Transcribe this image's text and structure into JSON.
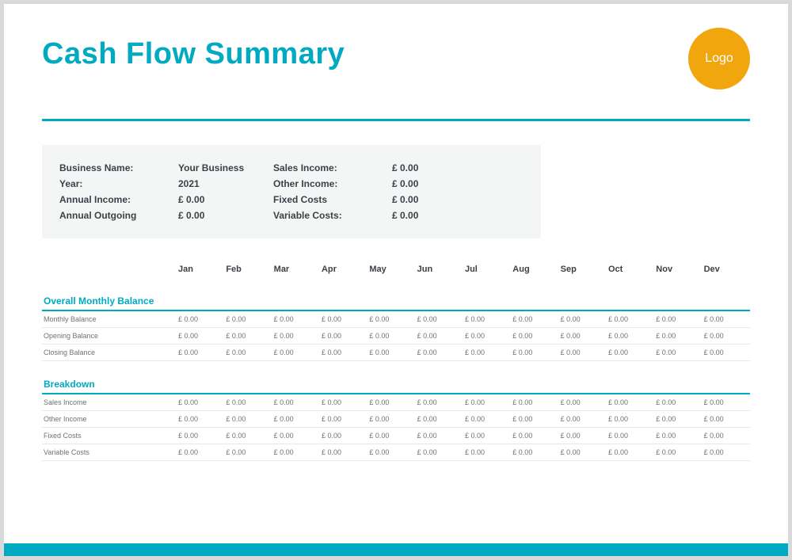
{
  "title": "Cash Flow Summary",
  "logo_text": "Logo",
  "summary": {
    "business_name_label": "Business Name:",
    "business_name_value": "Your Business",
    "year_label": "Year:",
    "year_value": "2021",
    "annual_income_label": "Annual Income:",
    "annual_income_value": "£ 0.00",
    "annual_outgoing_label": "Annual Outgoing",
    "annual_outgoing_value": "£ 0.00",
    "sales_income_label": "Sales Income:",
    "sales_income_value": "£ 0.00",
    "other_income_label": "Other Income:",
    "other_income_value": "£ 0.00",
    "fixed_costs_label": "Fixed Costs",
    "fixed_costs_value": "£ 0.00",
    "variable_costs_label": "Variable Costs:",
    "variable_costs_value": "£ 0.00"
  },
  "months": [
    "Jan",
    "Feb",
    "Mar",
    "Apr",
    "May",
    "Jun",
    "Jul",
    "Aug",
    "Sep",
    "Oct",
    "Nov",
    "Dev"
  ],
  "section1_title": "Overall Monthly Balance",
  "section1_rows": [
    {
      "label": "Monthly Balance",
      "vals": [
        "£ 0.00",
        "£ 0.00",
        "£ 0.00",
        "£ 0.00",
        "£ 0.00",
        "£ 0.00",
        "£ 0.00",
        "£ 0.00",
        "£ 0.00",
        "£ 0.00",
        "£ 0.00",
        "£ 0.00"
      ]
    },
    {
      "label": "Opening Balance",
      "vals": [
        "£ 0.00",
        "£ 0.00",
        "£ 0.00",
        "£ 0.00",
        "£ 0.00",
        "£ 0.00",
        "£ 0.00",
        "£ 0.00",
        "£ 0.00",
        "£ 0.00",
        "£ 0.00",
        "£ 0.00"
      ]
    },
    {
      "label": "Closing Balance",
      "vals": [
        "£ 0.00",
        "£ 0.00",
        "£ 0.00",
        "£ 0.00",
        "£ 0.00",
        "£ 0.00",
        "£ 0.00",
        "£ 0.00",
        "£ 0.00",
        "£ 0.00",
        "£ 0.00",
        "£ 0.00"
      ]
    }
  ],
  "section2_title": "Breakdown",
  "section2_rows": [
    {
      "label": "Sales Income",
      "vals": [
        "£ 0.00",
        "£ 0.00",
        "£ 0.00",
        "£ 0.00",
        "£ 0.00",
        "£ 0.00",
        "£ 0.00",
        "£ 0.00",
        "£ 0.00",
        "£ 0.00",
        "£ 0.00",
        "£ 0.00"
      ]
    },
    {
      "label": "Other Income",
      "vals": [
        "£ 0.00",
        "£ 0.00",
        "£ 0.00",
        "£ 0.00",
        "£ 0.00",
        "£ 0.00",
        "£ 0.00",
        "£ 0.00",
        "£ 0.00",
        "£ 0.00",
        "£ 0.00",
        "£ 0.00"
      ]
    },
    {
      "label": "Fixed Costs",
      "vals": [
        "£ 0.00",
        "£ 0.00",
        "£ 0.00",
        "£ 0.00",
        "£ 0.00",
        "£ 0.00",
        "£ 0.00",
        "£ 0.00",
        "£ 0.00",
        "£ 0.00",
        "£ 0.00",
        "£ 0.00"
      ]
    },
    {
      "label": "Variable Costs",
      "vals": [
        "£ 0.00",
        "£ 0.00",
        "£ 0.00",
        "£ 0.00",
        "£ 0.00",
        "£ 0.00",
        "£ 0.00",
        "£ 0.00",
        "£ 0.00",
        "£ 0.00",
        "£ 0.00",
        "£ 0.00"
      ]
    }
  ]
}
